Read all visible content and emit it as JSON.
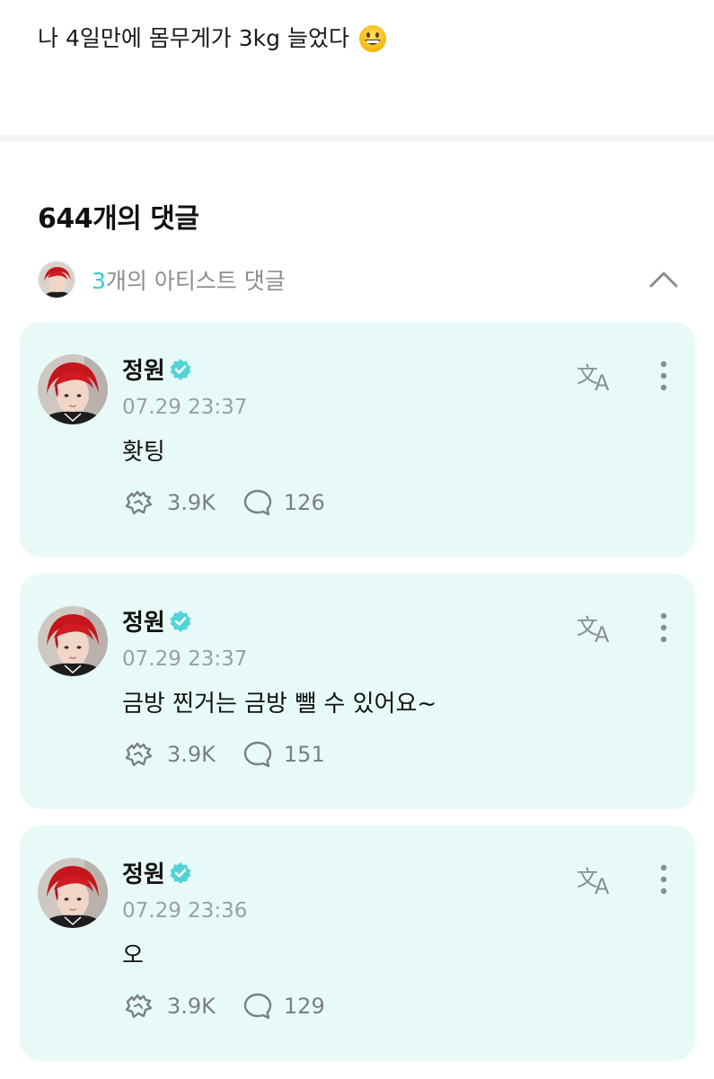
{
  "post": {
    "text": "나 4일만에 몸무게가 3kg 늘었다",
    "emoji": "grinning-face"
  },
  "comments_header": {
    "title": "644개의 댓글"
  },
  "artist_section": {
    "count": "3",
    "label": "개의 아티스트 댓글",
    "toggle_icon": "chevron-up-icon"
  },
  "colors": {
    "card_bg": "#e8faf7",
    "accent": "#3ec7d0",
    "muted": "#9a9ea3"
  },
  "comments": [
    {
      "name": "정원",
      "time": "07.29 23:37",
      "text": "홧팅",
      "likes": "3.9K",
      "replies": "126"
    },
    {
      "name": "정원",
      "time": "07.29 23:37",
      "text": "금방 찐거는 금방 뺄 수 있어요~",
      "likes": "3.9K",
      "replies": "151"
    },
    {
      "name": "정원",
      "time": "07.29 23:36",
      "text": "오",
      "likes": "3.9K",
      "replies": "129"
    }
  ]
}
